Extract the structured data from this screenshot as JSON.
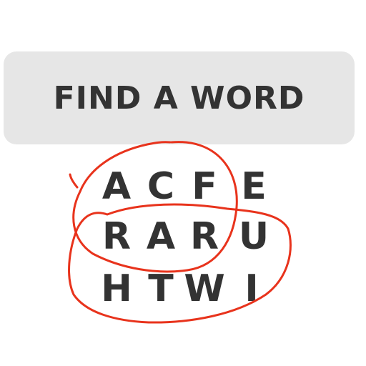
{
  "title": "FIND A WORD",
  "colors": {
    "banner_bg": "#e6e6e6",
    "text": "#333333",
    "circle": "#e8331c"
  },
  "grid": {
    "rows": [
      [
        "A",
        "C",
        "F",
        "E"
      ],
      [
        "R",
        "A",
        "R",
        "U"
      ],
      [
        "H",
        "T",
        "W",
        "I"
      ]
    ]
  },
  "circled_words": [
    [
      "A",
      "C",
      "F",
      "A",
      "R"
    ],
    [
      "R",
      "A",
      "R",
      "U",
      "T",
      "W",
      "I"
    ]
  ]
}
